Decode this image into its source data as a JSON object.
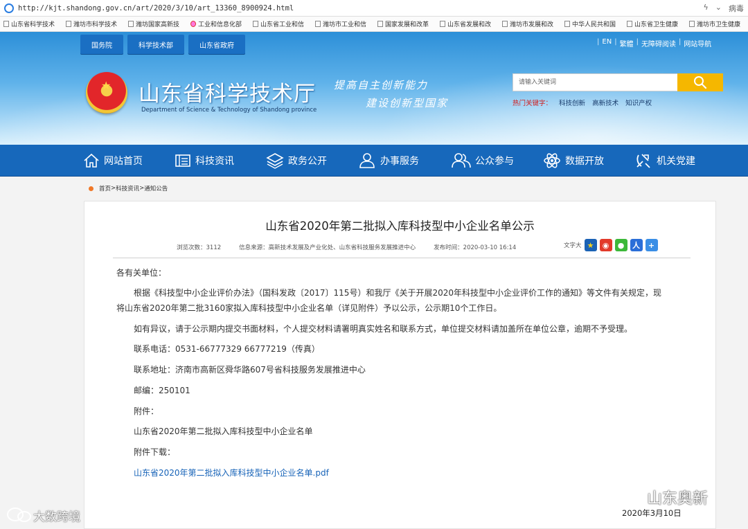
{
  "browser": {
    "url": "http://kjt.shandong.gov.cn/art/2020/3/10/art_13360_8900924.html",
    "right_text": "病毒",
    "favorites": [
      "山东省科学技术",
      "潍坊市科学技术",
      "潍坊国家高新技",
      "工业和信息化部",
      "山东省工业和信",
      "潍坊市工业和信",
      "国家发展和改革",
      "山东省发展和改",
      "潍坊市发展和改",
      "中华人民共和国",
      "山东省卫生健康",
      "潍坊市卫生健康"
    ]
  },
  "header": {
    "top_buttons": [
      "国务院",
      "科学技术部",
      "山东省政府"
    ],
    "top_links": [
      "EN",
      "繁體",
      "无障碍阅读",
      "网站导航"
    ],
    "site_title": "山东省科学技术厅",
    "site_subtitle": "Department of Science & Technology of Shandong province",
    "slogan_line1": "提高自主创新能力",
    "slogan_line2": "建设创新型国家",
    "search_placeholder": "请输入关键词",
    "hot_label": "热门关键字：",
    "hot_keywords": [
      "科技创新",
      "高新技术",
      "知识产权"
    ]
  },
  "nav": {
    "items": [
      {
        "label": "网站首页",
        "icon": "home-icon"
      },
      {
        "label": "科技资讯",
        "icon": "news-icon"
      },
      {
        "label": "政务公开",
        "icon": "layers-icon"
      },
      {
        "label": "办事服务",
        "icon": "person-service-icon"
      },
      {
        "label": "公众参与",
        "icon": "people-icon"
      },
      {
        "label": "数据开放",
        "icon": "atom-icon"
      },
      {
        "label": "机关党建",
        "icon": "party-icon"
      }
    ]
  },
  "breadcrumb": [
    "首页",
    "科技资讯",
    "通知公告"
  ],
  "article": {
    "title": "山东省2020年第二批拟入库科技型中小企业名单公示",
    "views": "浏览次数：3112",
    "source": "信息来源：高新技术发展及产业化处、山东省科技服务发展推进中心",
    "published": "发布时间：2020-03-10 16:14",
    "font_size_label": "文字大",
    "salutation": "各有关单位：",
    "para1_line1": "根据《科技型中小企业评价办法》（国科发政〔2017〕115号）和我厅《关于开展2020年科技型中小企业评价工作的通知》等文件有关规定，现",
    "para1_line2": "将山东省2020年第二批3160家拟入库科技型中小企业名单（详见附件）予以公示，公示期10个工作日。",
    "para2": "如有异议，请于公示期内提交书面材料，个人提交材料请署明真实姓名和联系方式，单位提交材料请加盖所在单位公章，逾期不予受理。",
    "phone": "联系电话：0531-66777329  66777219（传真）",
    "address": "联系地址：济南市高新区舜华路607号省科技服务发展推进中心",
    "postcode": "邮编：250101",
    "attachment_label": "附件：",
    "attachment_name": "山东省2020年第二批拟入库科技型中小企业名单",
    "download_label": "附件下载：",
    "download_link": "山东省2020年第二批拟入库科技型中小企业名单.pdf",
    "sign_date": "2020年3月10日"
  },
  "watermarks": {
    "left": "大数跨境",
    "right": "山东奥新"
  },
  "colors": {
    "nav_blue": "#1768bb",
    "search_button": "#f5b700",
    "link": "#1763b8",
    "hot_label": "#d21d1d"
  }
}
